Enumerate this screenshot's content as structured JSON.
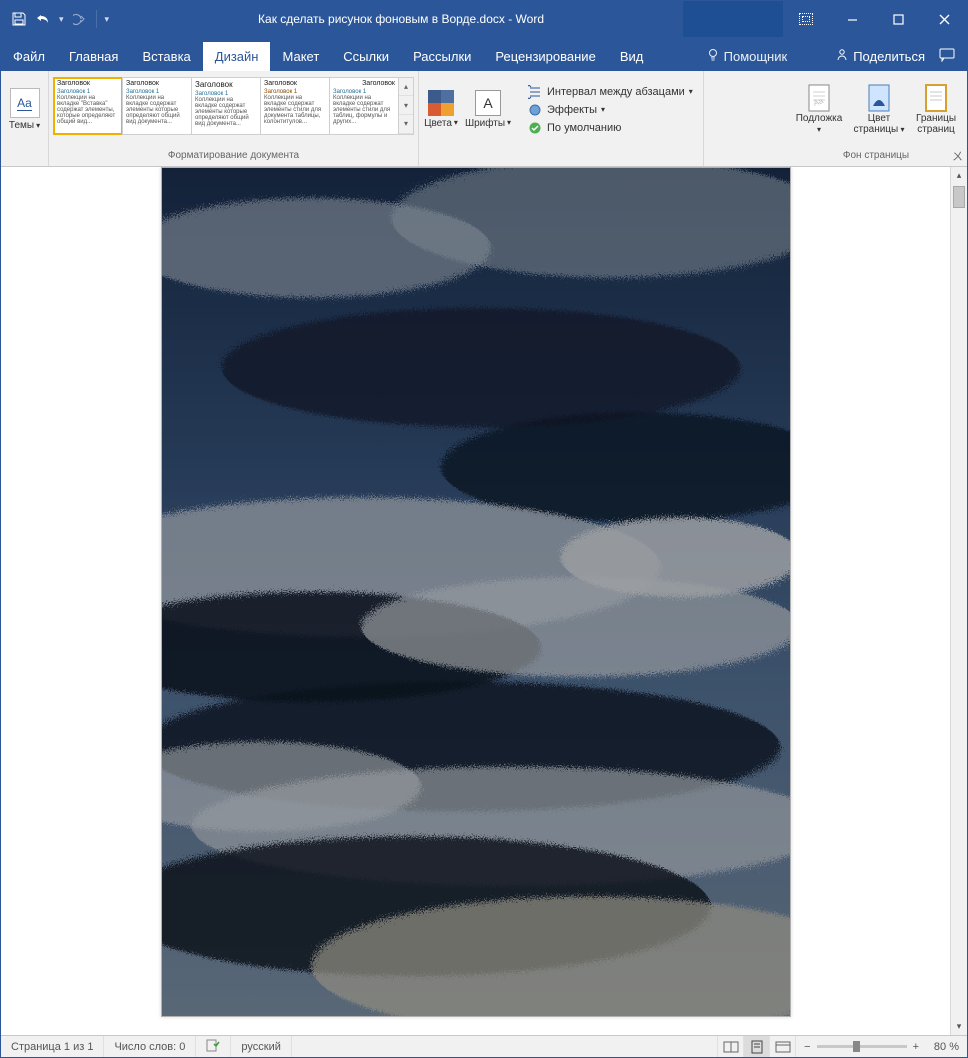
{
  "titlebar": {
    "title": "Как сделать рисунок фоновым в Ворде.docx - Word"
  },
  "tabs": {
    "file": "Файл",
    "home": "Главная",
    "insert": "Вставка",
    "design": "Дизайн",
    "layout": "Макет",
    "references": "Ссылки",
    "mailings": "Рассылки",
    "review": "Рецензирование",
    "view": "Вид",
    "tell": "Помощник",
    "share": "Поделиться"
  },
  "ribbon": {
    "themes": "Темы",
    "style_header": "Заголовок",
    "style_sub": "Заголовок 1",
    "formatting_label": "Форматирование документа",
    "colors": "Цвета",
    "fonts": "Шрифты",
    "para_spacing": "Интервал между абзацами",
    "effects": "Эффекты",
    "default": "По умолчанию",
    "watermark": "Подложка",
    "page_color": "Цвет страницы",
    "borders": "Границы страниц",
    "page_bg_label": "Фон страницы"
  },
  "status": {
    "page": "Страница 1 из 1",
    "words": "Число слов: 0",
    "lang": "русский",
    "zoom": "80 %"
  },
  "colors": {
    "c1": "#3c5b8a",
    "c2": "#4f6fa0",
    "c3": "#d85c32",
    "c4": "#f0a030"
  }
}
